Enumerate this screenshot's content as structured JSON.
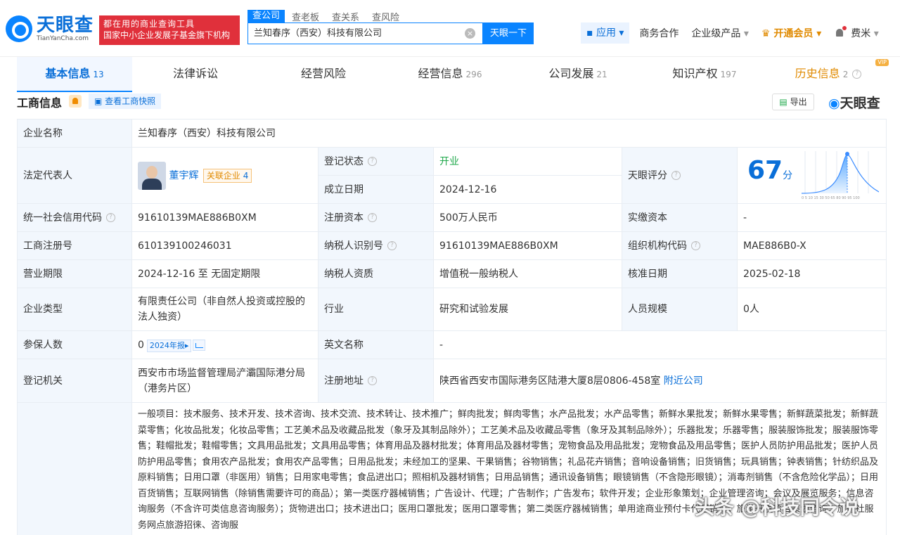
{
  "header": {
    "logo_cn": "天眼查",
    "logo_en": "TianYanCha.com",
    "promo_line1": "都在用的商业查询工具",
    "promo_line2": "国家中小企业发展子基金旗下机构",
    "search_tabs": [
      "查公司",
      "查老板",
      "查关系",
      "查风险"
    ],
    "search_value": "兰知春序（西安）科技有限公司",
    "search_button": "天眼一下",
    "nav": {
      "app": "应用",
      "business": "商务合作",
      "enterprise": "企业级产品",
      "vip": "开通会员",
      "user": "费米"
    }
  },
  "tabs": [
    {
      "label": "基本信息",
      "count": "13"
    },
    {
      "label": "法律诉讼",
      "count": ""
    },
    {
      "label": "经营风险",
      "count": ""
    },
    {
      "label": "经营信息",
      "count": "296"
    },
    {
      "label": "公司发展",
      "count": "21"
    },
    {
      "label": "知识产权",
      "count": "197"
    },
    {
      "label": "历史信息",
      "count": "2",
      "badge": "VIP"
    }
  ],
  "section": {
    "title": "工商信息",
    "snapshot_button": "查看工商快照",
    "export_button": "导出",
    "brand": "天眼查"
  },
  "info": {
    "company_name_label": "企业名称",
    "company_name": "兰知春序（西安）科技有限公司",
    "legal_rep_label": "法定代表人",
    "legal_rep": "董宇辉",
    "related_label": "关联企业",
    "related_count": "4",
    "reg_status_label": "登记状态",
    "reg_status": "开业",
    "found_date_label": "成立日期",
    "found_date": "2024-12-16",
    "score_label": "天眼评分",
    "score": "67",
    "score_unit": "分",
    "credit_code_label": "统一社会信用代码",
    "credit_code": "91610139MAE886B0XM",
    "reg_capital_label": "注册资本",
    "reg_capital": "500万人民币",
    "paid_capital_label": "实缴资本",
    "paid_capital": "-",
    "reg_no_label": "工商注册号",
    "reg_no": "610139100246031",
    "taxpayer_id_label": "纳税人识别号",
    "taxpayer_id": "91610139MAE886B0XM",
    "org_code_label": "组织机构代码",
    "org_code": "MAE886B0-X",
    "term_label": "营业期限",
    "term": "2024-12-16 至 无固定期限",
    "taxpayer_qual_label": "纳税人资质",
    "taxpayer_qual": "增值税一般纳税人",
    "approve_date_label": "核准日期",
    "approve_date": "2025-02-18",
    "type_label": "企业类型",
    "type": "有限责任公司（非自然人投资或控股的法人独资）",
    "industry_label": "行业",
    "industry": "研究和试验发展",
    "staff_label": "人员规模",
    "staff": "0人",
    "insured_label": "参保人数",
    "insured": "0",
    "insured_report": "2024年报",
    "english_label": "英文名称",
    "english": "-",
    "authority_label": "登记机关",
    "authority": "西安市市场监督管理局浐灞国际港分局（港务片区）",
    "address_label": "注册地址",
    "address": "陕西省西安市国际港务区陆港大厦8层0806-458室",
    "nearby": "附近公司",
    "scope": "一般项目：技术服务、技术开发、技术咨询、技术交流、技术转让、技术推广；鲜肉批发；鲜肉零售；水产品批发；水产品零售；新鲜水果批发；新鲜水果零售；新鲜蔬菜批发；新鲜蔬菜零售；化妆品批发；化妆品零售；工艺美术品及收藏品批发（象牙及其制品除外）；工艺美术品及收藏品零售（象牙及其制品除外）；乐器批发；乐器零售；服装服饰批发；服装服饰零售；鞋帽批发；鞋帽零售；文具用品批发；文具用品零售；体育用品及器材批发；体育用品及器材零售；宠物食品及用品批发；宠物食品及用品零售；医护人员防护用品批发；医护人员防护用品零售；食用农产品批发；食用农产品零售；日用品批发；未经加工的坚果、干果销售；谷物销售；礼品花卉销售；音响设备销售；旧货销售；玩具销售；钟表销售；针纺织品及原料销售；日用口罩（非医用）销售；日用家电零售；食品进出口；照相机及器材销售；日用品销售；通讯设备销售；眼镜销售（不含隐形眼镜）；消毒剂销售（不含危险化学品）；日用百货销售；互联网销售（除销售需要许可的商品）；第一类医疗器械销售；广告设计、代理；广告制作；广告发布；软件开发；企业形象策划；企业管理咨询；会议及展览服务；信息咨询服务（不含许可类信息咨询服务）；货物进出口；技术进出口；医用口罩批发；医用口罩零售；第二类医疗器械销售；单用途商业预付卡代理销售；旅游开发项目策划咨询；旅行社服务网点旅游招徕、咨询服"
  },
  "watermark": "头条 @科技同令说"
}
